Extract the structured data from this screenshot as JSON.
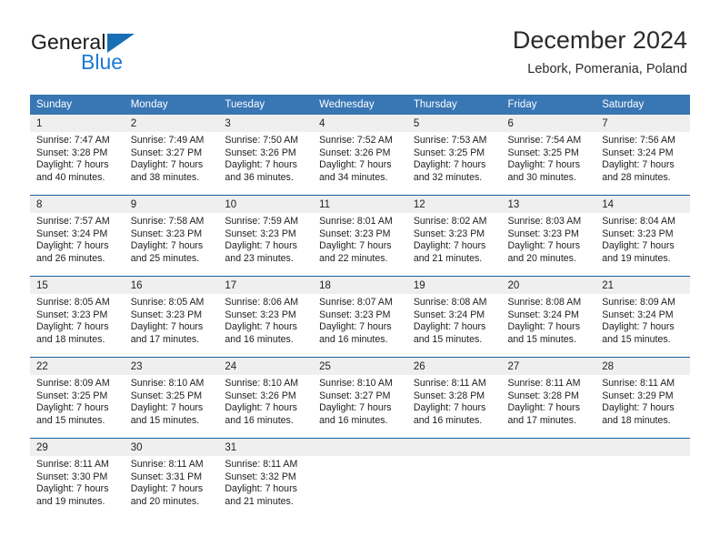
{
  "brand": {
    "name_dark": "General",
    "name_blue": "Blue",
    "triangle_color": "#1a6fb4"
  },
  "header": {
    "title": "December 2024",
    "subtitle": "Lebork, Pomerania, Poland"
  },
  "theme": {
    "header_bg": "#3876b4",
    "header_text": "#ffffff",
    "daynum_bg": "#efefef",
    "divider": "#1a5fa0"
  },
  "weekdays": [
    "Sunday",
    "Monday",
    "Tuesday",
    "Wednesday",
    "Thursday",
    "Friday",
    "Saturday"
  ],
  "weeks": [
    [
      {
        "day": "1",
        "sunrise": "Sunrise: 7:47 AM",
        "sunset": "Sunset: 3:28 PM",
        "daylight1": "Daylight: 7 hours",
        "daylight2": "and 40 minutes."
      },
      {
        "day": "2",
        "sunrise": "Sunrise: 7:49 AM",
        "sunset": "Sunset: 3:27 PM",
        "daylight1": "Daylight: 7 hours",
        "daylight2": "and 38 minutes."
      },
      {
        "day": "3",
        "sunrise": "Sunrise: 7:50 AM",
        "sunset": "Sunset: 3:26 PM",
        "daylight1": "Daylight: 7 hours",
        "daylight2": "and 36 minutes."
      },
      {
        "day": "4",
        "sunrise": "Sunrise: 7:52 AM",
        "sunset": "Sunset: 3:26 PM",
        "daylight1": "Daylight: 7 hours",
        "daylight2": "and 34 minutes."
      },
      {
        "day": "5",
        "sunrise": "Sunrise: 7:53 AM",
        "sunset": "Sunset: 3:25 PM",
        "daylight1": "Daylight: 7 hours",
        "daylight2": "and 32 minutes."
      },
      {
        "day": "6",
        "sunrise": "Sunrise: 7:54 AM",
        "sunset": "Sunset: 3:25 PM",
        "daylight1": "Daylight: 7 hours",
        "daylight2": "and 30 minutes."
      },
      {
        "day": "7",
        "sunrise": "Sunrise: 7:56 AM",
        "sunset": "Sunset: 3:24 PM",
        "daylight1": "Daylight: 7 hours",
        "daylight2": "and 28 minutes."
      }
    ],
    [
      {
        "day": "8",
        "sunrise": "Sunrise: 7:57 AM",
        "sunset": "Sunset: 3:24 PM",
        "daylight1": "Daylight: 7 hours",
        "daylight2": "and 26 minutes."
      },
      {
        "day": "9",
        "sunrise": "Sunrise: 7:58 AM",
        "sunset": "Sunset: 3:23 PM",
        "daylight1": "Daylight: 7 hours",
        "daylight2": "and 25 minutes."
      },
      {
        "day": "10",
        "sunrise": "Sunrise: 7:59 AM",
        "sunset": "Sunset: 3:23 PM",
        "daylight1": "Daylight: 7 hours",
        "daylight2": "and 23 minutes."
      },
      {
        "day": "11",
        "sunrise": "Sunrise: 8:01 AM",
        "sunset": "Sunset: 3:23 PM",
        "daylight1": "Daylight: 7 hours",
        "daylight2": "and 22 minutes."
      },
      {
        "day": "12",
        "sunrise": "Sunrise: 8:02 AM",
        "sunset": "Sunset: 3:23 PM",
        "daylight1": "Daylight: 7 hours",
        "daylight2": "and 21 minutes."
      },
      {
        "day": "13",
        "sunrise": "Sunrise: 8:03 AM",
        "sunset": "Sunset: 3:23 PM",
        "daylight1": "Daylight: 7 hours",
        "daylight2": "and 20 minutes."
      },
      {
        "day": "14",
        "sunrise": "Sunrise: 8:04 AM",
        "sunset": "Sunset: 3:23 PM",
        "daylight1": "Daylight: 7 hours",
        "daylight2": "and 19 minutes."
      }
    ],
    [
      {
        "day": "15",
        "sunrise": "Sunrise: 8:05 AM",
        "sunset": "Sunset: 3:23 PM",
        "daylight1": "Daylight: 7 hours",
        "daylight2": "and 18 minutes."
      },
      {
        "day": "16",
        "sunrise": "Sunrise: 8:05 AM",
        "sunset": "Sunset: 3:23 PM",
        "daylight1": "Daylight: 7 hours",
        "daylight2": "and 17 minutes."
      },
      {
        "day": "17",
        "sunrise": "Sunrise: 8:06 AM",
        "sunset": "Sunset: 3:23 PM",
        "daylight1": "Daylight: 7 hours",
        "daylight2": "and 16 minutes."
      },
      {
        "day": "18",
        "sunrise": "Sunrise: 8:07 AM",
        "sunset": "Sunset: 3:23 PM",
        "daylight1": "Daylight: 7 hours",
        "daylight2": "and 16 minutes."
      },
      {
        "day": "19",
        "sunrise": "Sunrise: 8:08 AM",
        "sunset": "Sunset: 3:24 PM",
        "daylight1": "Daylight: 7 hours",
        "daylight2": "and 15 minutes."
      },
      {
        "day": "20",
        "sunrise": "Sunrise: 8:08 AM",
        "sunset": "Sunset: 3:24 PM",
        "daylight1": "Daylight: 7 hours",
        "daylight2": "and 15 minutes."
      },
      {
        "day": "21",
        "sunrise": "Sunrise: 8:09 AM",
        "sunset": "Sunset: 3:24 PM",
        "daylight1": "Daylight: 7 hours",
        "daylight2": "and 15 minutes."
      }
    ],
    [
      {
        "day": "22",
        "sunrise": "Sunrise: 8:09 AM",
        "sunset": "Sunset: 3:25 PM",
        "daylight1": "Daylight: 7 hours",
        "daylight2": "and 15 minutes."
      },
      {
        "day": "23",
        "sunrise": "Sunrise: 8:10 AM",
        "sunset": "Sunset: 3:25 PM",
        "daylight1": "Daylight: 7 hours",
        "daylight2": "and 15 minutes."
      },
      {
        "day": "24",
        "sunrise": "Sunrise: 8:10 AM",
        "sunset": "Sunset: 3:26 PM",
        "daylight1": "Daylight: 7 hours",
        "daylight2": "and 16 minutes."
      },
      {
        "day": "25",
        "sunrise": "Sunrise: 8:10 AM",
        "sunset": "Sunset: 3:27 PM",
        "daylight1": "Daylight: 7 hours",
        "daylight2": "and 16 minutes."
      },
      {
        "day": "26",
        "sunrise": "Sunrise: 8:11 AM",
        "sunset": "Sunset: 3:28 PM",
        "daylight1": "Daylight: 7 hours",
        "daylight2": "and 16 minutes."
      },
      {
        "day": "27",
        "sunrise": "Sunrise: 8:11 AM",
        "sunset": "Sunset: 3:28 PM",
        "daylight1": "Daylight: 7 hours",
        "daylight2": "and 17 minutes."
      },
      {
        "day": "28",
        "sunrise": "Sunrise: 8:11 AM",
        "sunset": "Sunset: 3:29 PM",
        "daylight1": "Daylight: 7 hours",
        "daylight2": "and 18 minutes."
      }
    ],
    [
      {
        "day": "29",
        "sunrise": "Sunrise: 8:11 AM",
        "sunset": "Sunset: 3:30 PM",
        "daylight1": "Daylight: 7 hours",
        "daylight2": "and 19 minutes."
      },
      {
        "day": "30",
        "sunrise": "Sunrise: 8:11 AM",
        "sunset": "Sunset: 3:31 PM",
        "daylight1": "Daylight: 7 hours",
        "daylight2": "and 20 minutes."
      },
      {
        "day": "31",
        "sunrise": "Sunrise: 8:11 AM",
        "sunset": "Sunset: 3:32 PM",
        "daylight1": "Daylight: 7 hours",
        "daylight2": "and 21 minutes."
      },
      {
        "day": "",
        "sunrise": "",
        "sunset": "",
        "daylight1": "",
        "daylight2": ""
      },
      {
        "day": "",
        "sunrise": "",
        "sunset": "",
        "daylight1": "",
        "daylight2": ""
      },
      {
        "day": "",
        "sunrise": "",
        "sunset": "",
        "daylight1": "",
        "daylight2": ""
      },
      {
        "day": "",
        "sunrise": "",
        "sunset": "",
        "daylight1": "",
        "daylight2": ""
      }
    ]
  ]
}
